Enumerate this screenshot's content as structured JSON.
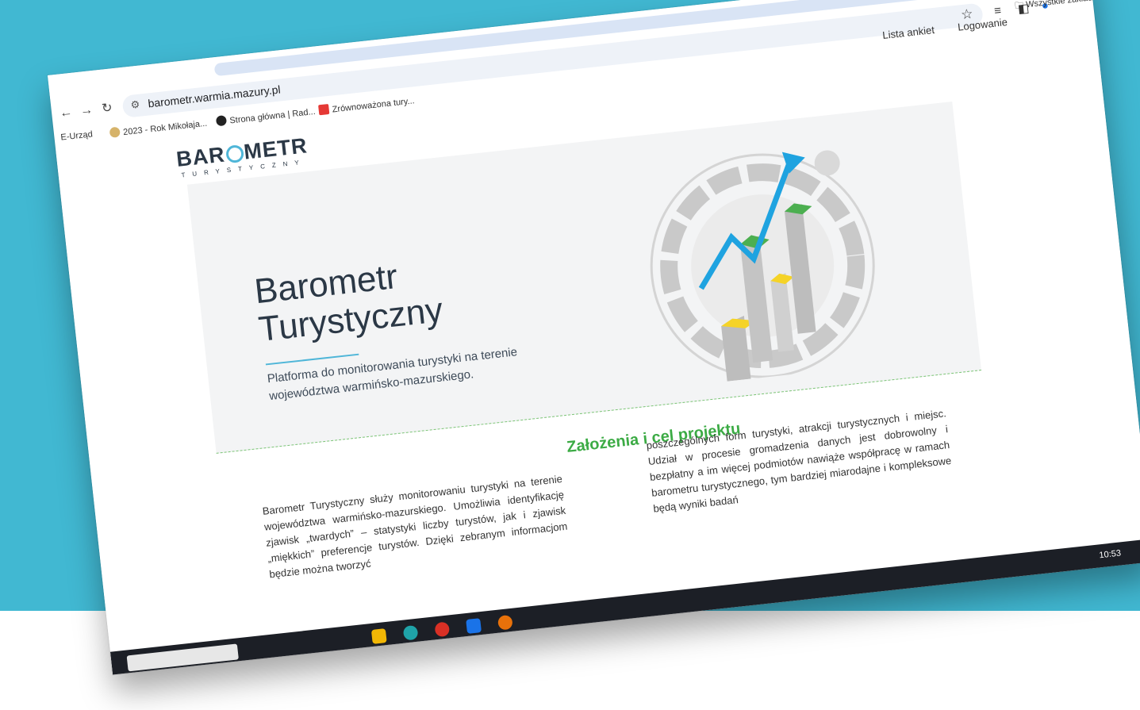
{
  "browser": {
    "url": "barometr.warmia.mazury.pl",
    "bookmarks": [
      {
        "label": "E-Urząd",
        "color": "#cccccc"
      },
      {
        "label": "2023 - Rok Mikołaja...",
        "color": "#d6b36a"
      },
      {
        "label": "Strona główna | Rad...",
        "color": "#222222"
      },
      {
        "label": "Zrównoważona tury...",
        "color": "#e53935"
      }
    ],
    "all_bookmarks": "Wszystkie zakład"
  },
  "site": {
    "logo_part1": "BAR",
    "logo_part2": "METR",
    "logo_sub": "TURYSTYCZNY",
    "nav": [
      "Lista ankiet",
      "Logowanie"
    ],
    "hero_title_line1": "Barometr",
    "hero_title_line2": "Turystyczny",
    "hero_subtitle": "Platforma do monitorowania turystyki na terenie województwa warmińsko-mazurskiego.",
    "section_title": "Założenia i cel projektu",
    "col1": "Barometr Turystyczny służy monitorowaniu turystyki na terenie województwa warmińsko-mazurskiego. Umożliwia identyfikację zjawisk „twardych” – statystyki liczby turystów, jak i zjawisk „miękkich” preferencje turystów. Dzięki zebranym informacjom będzie można tworzyć",
    "col2": "poszczególnych form turystyki, atrakcji turystycznych i miejsc. Udział w procesie gromadzenia danych jest dobrowolny i bezpłatny a im więcej podmiotów nawiąże współpracę w ramach barometru turystycznego, tym bardziej miarodajne i kompleksowe będą wyniki badań"
  },
  "taskbar": {
    "clock": "10:53"
  },
  "colors": {
    "background": "#41b8d2",
    "accent_green": "#3cab45",
    "accent_blue": "#4fb6d8"
  }
}
